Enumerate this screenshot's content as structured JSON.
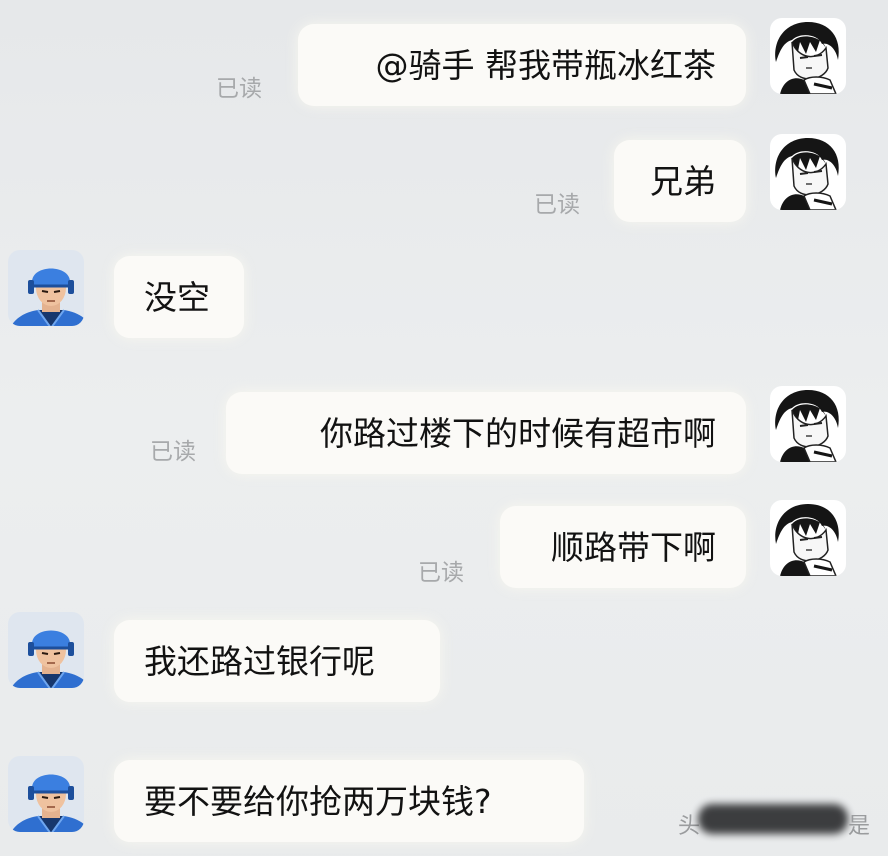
{
  "messages": [
    {
      "side": "right",
      "text": "@骑手 帮我带瓶冰红茶",
      "status": "已读"
    },
    {
      "side": "right",
      "text": "兄弟",
      "status": "已读"
    },
    {
      "side": "left",
      "text": "没空"
    },
    {
      "side": "right",
      "text": "你路过楼下的时候有超市啊",
      "status": "已读"
    },
    {
      "side": "right",
      "text": "顺路带下啊",
      "status": "已读"
    },
    {
      "side": "left",
      "text": "我还路过银行呢"
    },
    {
      "side": "left",
      "text": "要不要给你抢两万块钱?"
    }
  ],
  "avatars": {
    "self": "anime-boy-avatar",
    "rider": "delivery-rider-avatar"
  },
  "colors": {
    "bubble": "#fbfaf7",
    "read_status": "#a7a9ab",
    "rider_blue": "#2f6fd0"
  },
  "watermark": {
    "left": "头",
    "right": "是"
  }
}
